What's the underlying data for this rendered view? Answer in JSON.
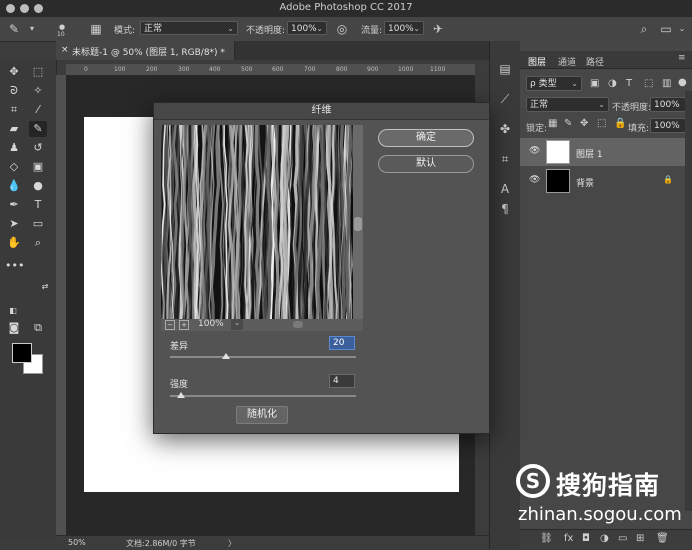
{
  "app": {
    "title": "Adobe Photoshop CC 2017"
  },
  "options_bar": {
    "brush_size": "10",
    "mode_label": "模式:",
    "mode_value": "正常",
    "opacity_label": "不透明度:",
    "opacity_value": "100%",
    "flow_label": "流量:",
    "flow_value": "100%"
  },
  "document_tab": {
    "label": "未标题-1 @ 50% (图层 1, RGB/8*) *",
    "close": "×"
  },
  "ruler_ticks": [
    "0",
    "100",
    "200",
    "300",
    "400",
    "500",
    "600",
    "700",
    "800",
    "900",
    "1000",
    "1100"
  ],
  "status_bar": {
    "zoom": "50%",
    "doc_info": "文档:2.86M/0 字节",
    "arrow": "〉"
  },
  "dialog": {
    "title": "纤维",
    "ok_label": "确定",
    "default_label": "默认",
    "zoom": "100%",
    "variance_label": "差异",
    "variance_value": "20",
    "variance_level": 0.3,
    "strength_label": "强度",
    "strength_value": "4",
    "strength_level": 0.06,
    "randomize_label": "随机化"
  },
  "layers_panel": {
    "tabs": [
      "图层",
      "通道",
      "路径"
    ],
    "filter_kind": "ρ 类型",
    "blend_mode": "正常",
    "opacity_label": "不透明度:",
    "opacity_value": "100%",
    "lock_label": "锁定:",
    "fill_label": "填充:",
    "fill_value": "100%",
    "layers": [
      {
        "name": "图层 1",
        "thumb_color": "#ffffff",
        "selected": true
      },
      {
        "name": "背景",
        "thumb_color": "#000000",
        "selected": false
      }
    ]
  },
  "watermark": {
    "logo": "S",
    "name": "搜狗指南",
    "url": "zhinan.sogou.com"
  }
}
